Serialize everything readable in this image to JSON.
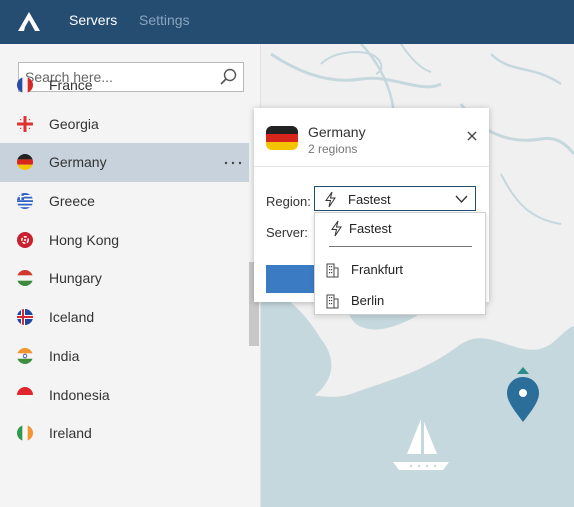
{
  "header": {
    "logo_icon": "nordvpn-mountain-icon",
    "tabs": [
      {
        "label": "Servers",
        "active": true
      },
      {
        "label": "Settings",
        "active": false
      }
    ]
  },
  "sidebar": {
    "search": {
      "placeholder": "Search here...",
      "value": ""
    },
    "countries": [
      {
        "name": "France",
        "flag_icon": "france-flag-icon",
        "selected": false
      },
      {
        "name": "Georgia",
        "flag_icon": "georgia-flag-icon",
        "selected": false
      },
      {
        "name": "Germany",
        "flag_icon": "germany-flag-icon",
        "selected": true
      },
      {
        "name": "Greece",
        "flag_icon": "greece-flag-icon",
        "selected": false
      },
      {
        "name": "Hong Kong",
        "flag_icon": "hong-kong-flag-icon",
        "selected": false
      },
      {
        "name": "Hungary",
        "flag_icon": "hungary-flag-icon",
        "selected": false
      },
      {
        "name": "Iceland",
        "flag_icon": "iceland-flag-icon",
        "selected": false
      },
      {
        "name": "India",
        "flag_icon": "india-flag-icon",
        "selected": false
      },
      {
        "name": "Indonesia",
        "flag_icon": "indonesia-flag-icon",
        "selected": false
      },
      {
        "name": "Ireland",
        "flag_icon": "ireland-flag-icon",
        "selected": false
      }
    ]
  },
  "popup": {
    "country": "Germany",
    "regions_count": "2 regions",
    "region_label": "Region:",
    "server_label": "Server:",
    "region_select": {
      "selected": "Fastest",
      "options": [
        {
          "label": "Fastest",
          "icon": "lightning-bolt-icon"
        },
        {
          "label": "Frankfurt",
          "icon": "building-icon"
        },
        {
          "label": "Berlin",
          "icon": "building-icon"
        }
      ]
    }
  },
  "colors": {
    "header_bg": "#254d72",
    "accent_blue": "#3a7bc4",
    "map_water": "#c5d8de",
    "map_pin": "#2c6e9a",
    "selected_row": "#c7d2dc"
  }
}
